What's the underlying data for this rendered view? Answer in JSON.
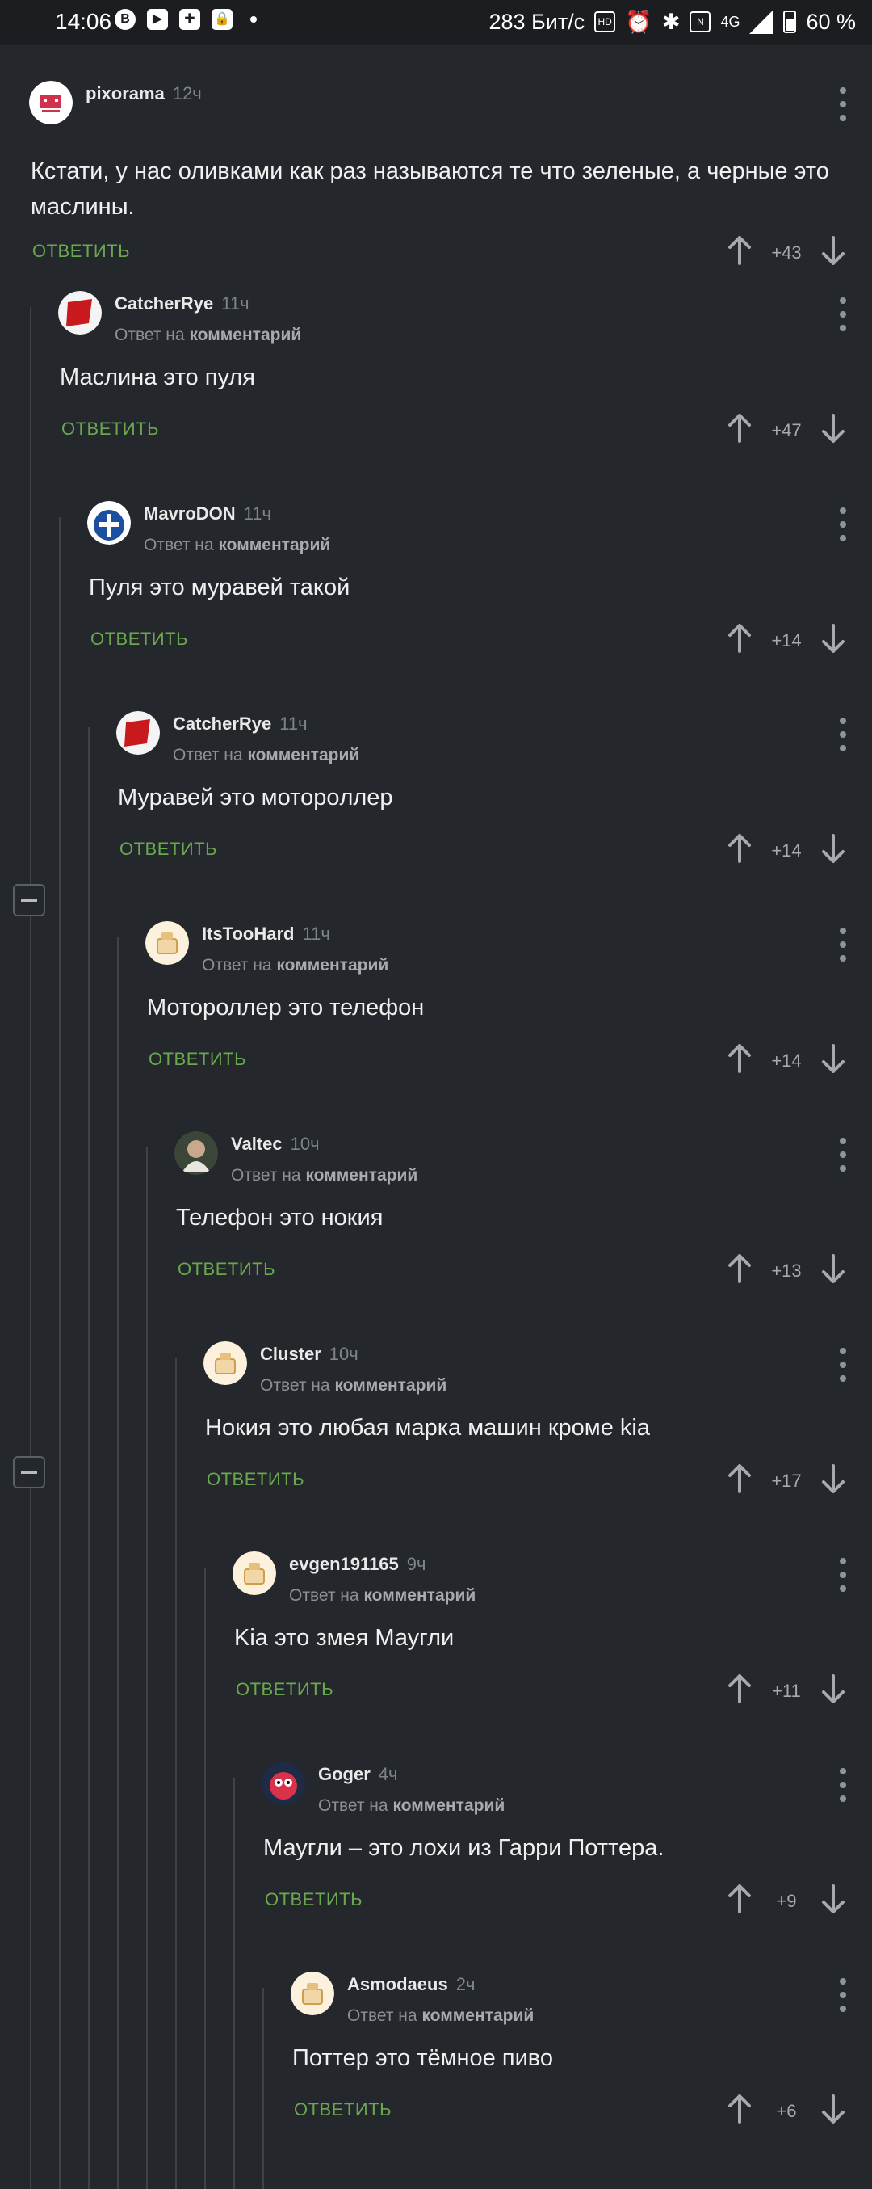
{
  "status_bar": {
    "time": "14:06",
    "speed": "283 Бит/с",
    "network": "4G",
    "battery": "60 %"
  },
  "ui": {
    "reply_label": "ОТВЕТИТЬ",
    "reply_to_prefix": "Ответ на",
    "reply_to_target": "комментарий"
  },
  "comments": [
    {
      "author": "pixorama",
      "time": "12ч",
      "text": "Кстати, у нас оливками как раз называются те что зеленые, а черные это маслины.",
      "score": "+43",
      "avatar": "pixorama-avatar",
      "avatar_color": "#ffffff"
    },
    {
      "author": "CatcherRye",
      "time": "11ч",
      "text": "Маслина это пуля",
      "score": "+47",
      "avatar": "red-flag-avatar",
      "avatar_color": "#c8191c"
    },
    {
      "author": "MavroDON",
      "time": "11ч",
      "text": "Пуля это муравей такой",
      "score": "+14",
      "avatar": "greek-crest-avatar",
      "avatar_color": "#1c4fa0"
    },
    {
      "author": "CatcherRye",
      "time": "11ч",
      "text": "Муравей это моторoллер",
      "score": "+14",
      "avatar": "red-flag-avatar",
      "avatar_color": "#c8191c"
    },
    {
      "author": "ItsTooHard",
      "time": "11ч",
      "text": "Мотороллер это телефон",
      "score": "+14",
      "avatar": "default-avatar",
      "avatar_color": "#f2d7a6"
    },
    {
      "author": "Valtec",
      "time": "10ч",
      "text": "Телефон это нокия",
      "score": "+13",
      "avatar": "photo-avatar",
      "avatar_color": "#5a5a4a"
    },
    {
      "author": "Cluster",
      "time": "10ч",
      "text": "Нокия это любая марка машин кроме kia",
      "score": "+17",
      "avatar": "default-avatar",
      "avatar_color": "#f2d7a6"
    },
    {
      "author": "evgen191165",
      "time": "9ч",
      "text": "Kia это змея Маугли",
      "score": "+11",
      "avatar": "default-avatar",
      "avatar_color": "#f2d7a6"
    },
    {
      "author": "Goger",
      "time": "4ч",
      "text": "Маугли – это лохи из Гарри Поттера.",
      "score": "+9",
      "avatar": "cartoon-avatar",
      "avatar_color": "#d8334a"
    },
    {
      "author": "Asmodaeus",
      "time": "2ч",
      "text": "Поттер это тёмное пиво",
      "score": "+6",
      "avatar": "default-avatar",
      "avatar_color": "#f2d7a6"
    }
  ]
}
